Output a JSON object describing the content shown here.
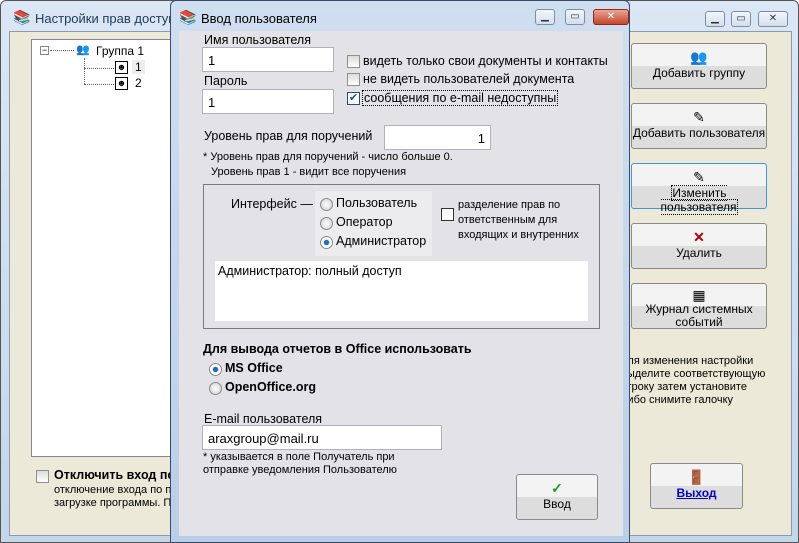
{
  "main_window": {
    "title": "Настройки прав доступа",
    "tree": {
      "group": "Группа 1",
      "users": [
        "1",
        "2"
      ]
    },
    "buttons": {
      "add_group": "Добавить группу",
      "add_user": "Добавить пользователя",
      "edit_user": "Изменить пользователя",
      "delete": "Удалить",
      "system_log": "Журнал системных событий",
      "exit": "Выход"
    },
    "hint": [
      "для изменения настройки",
      "выделите соответствующую",
      "строку затем установите",
      "либо снимите галочку"
    ],
    "disable_login": {
      "label": "Отключить вход по",
      "desc": [
        "отключение входа по па",
        "загрузке программы. П"
      ],
      "checked": false
    }
  },
  "dialog": {
    "title": "Ввод пользователя",
    "username_label": "Имя пользователя",
    "username_value": "1",
    "password_label": "Пароль",
    "password_value": "1",
    "options": [
      {
        "label": "видеть только свои документы и контакты",
        "checked": false
      },
      {
        "label": "не видеть пользователей документа",
        "checked": false
      },
      {
        "label": "сообщения по e-mail недоступны",
        "checked": true
      }
    ],
    "level_label": "Уровень прав для поручений",
    "level_value": "1",
    "level_note1": "* Уровень прав для поручений - число больше 0.",
    "level_note2": "Уровень прав 1 - видит все поручения",
    "interface_label": "Интерфейс —",
    "interface_options": [
      {
        "label": "Пользователь",
        "selected": false
      },
      {
        "label": "Оператор",
        "selected": false
      },
      {
        "label": "Администратор",
        "selected": true
      }
    ],
    "split_rights": {
      "label": "разделение прав по ответственным для входящих и внутренних",
      "checked": false
    },
    "interface_desc": "Администратор: полный доступ",
    "office_label": "Для вывода отчетов в Office использовать",
    "office_options": [
      {
        "label": "MS Office",
        "selected": true
      },
      {
        "label": "OpenOffice.org",
        "selected": false
      }
    ],
    "email_label": "E-mail пользователя",
    "email_value": "araxgroup@mail.ru",
    "email_note1": "* указывается в поле Получатель при",
    "email_note2": "отправке уведомления Пользователю",
    "submit": "Ввод"
  }
}
